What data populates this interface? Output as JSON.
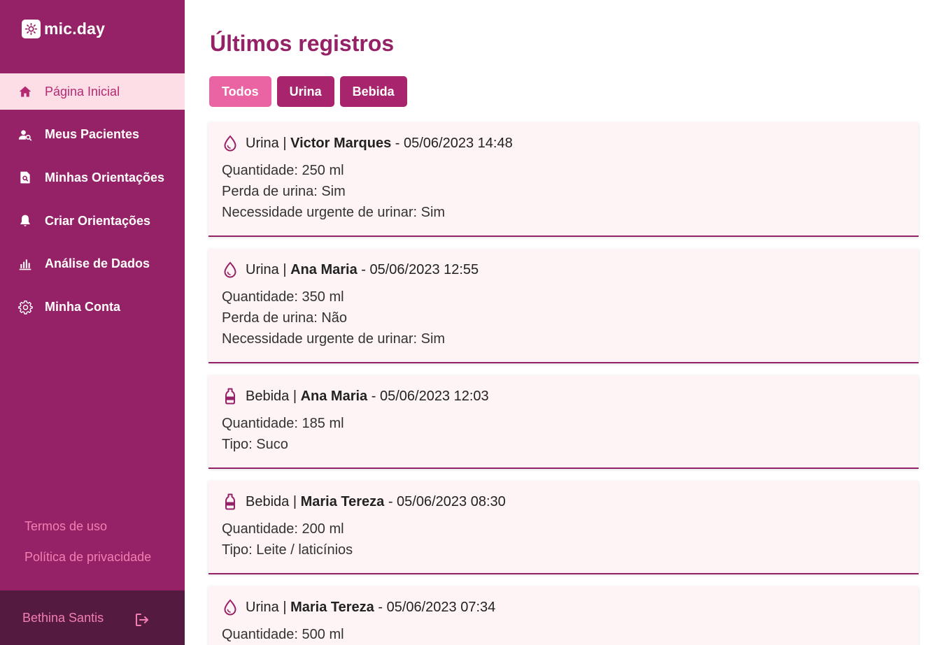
{
  "brand": {
    "name": "mic.day",
    "icon": "sun-logo-icon"
  },
  "sidebar": {
    "items": [
      {
        "label": "Página Inicial",
        "icon": "home-icon",
        "active": true
      },
      {
        "label": "Meus Pacientes",
        "icon": "patient-search-icon",
        "active": false
      },
      {
        "label": "Minhas Orientações",
        "icon": "document-search-icon",
        "active": false
      },
      {
        "label": "Criar Orientações",
        "icon": "bell-icon",
        "active": false
      },
      {
        "label": "Análise de Dados",
        "icon": "bar-chart-icon",
        "active": false
      },
      {
        "label": "Minha Conta",
        "icon": "gear-icon",
        "active": false
      }
    ],
    "links": [
      {
        "label": "Termos de uso"
      },
      {
        "label": "Política de privacidade"
      }
    ],
    "user": {
      "name": "Bethina Santis",
      "logout_icon": "logout-icon"
    }
  },
  "main": {
    "title": "Últimos registros",
    "filters": [
      {
        "label": "Todos",
        "active": true
      },
      {
        "label": "Urina",
        "active": false
      },
      {
        "label": "Bebida",
        "active": false
      }
    ],
    "records": [
      {
        "kind": "urine",
        "icon": "droplet-icon",
        "type": "Urina",
        "sep": " | ",
        "patient": "Victor Marques",
        "datetime": " - 05/06/2023 14:48",
        "lines": [
          "Quantidade: 250 ml",
          "Perda de urina: Sim",
          "Necessidade urgente de urinar: Sim"
        ]
      },
      {
        "kind": "urine",
        "icon": "droplet-icon",
        "type": "Urina",
        "sep": " | ",
        "patient": "Ana Maria",
        "datetime": " - 05/06/2023 12:55",
        "lines": [
          "Quantidade: 350 ml",
          "Perda de urina: Não",
          "Necessidade urgente de urinar: Sim"
        ]
      },
      {
        "kind": "drink",
        "icon": "bottle-icon",
        "type": "Bebida",
        "sep": " | ",
        "patient": "Ana Maria",
        "datetime": " - 05/06/2023 12:03",
        "lines": [
          "Quantidade: 185 ml",
          "Tipo: Suco"
        ]
      },
      {
        "kind": "drink",
        "icon": "bottle-icon",
        "type": "Bebida",
        "sep": " | ",
        "patient": "Maria Tereza",
        "datetime": " - 05/06/2023 08:30",
        "lines": [
          "Quantidade: 200 ml",
          "Tipo: Leite / laticínios"
        ]
      },
      {
        "kind": "urine",
        "icon": "droplet-icon",
        "type": "Urina",
        "sep": " | ",
        "patient": "Maria Tereza",
        "datetime": " - 05/06/2023 07:34",
        "lines": [
          "Quantidade: 500 ml"
        ]
      }
    ]
  },
  "colors": {
    "sidebar_bg": "#952266",
    "active_nav_bg": "#fddde6",
    "accent_pink": "#ea63a3",
    "button_magenta": "#a8256e",
    "card_bg": "#fff4f5",
    "user_bar_bg": "#541a40",
    "link_pink": "#f47fb2"
  }
}
